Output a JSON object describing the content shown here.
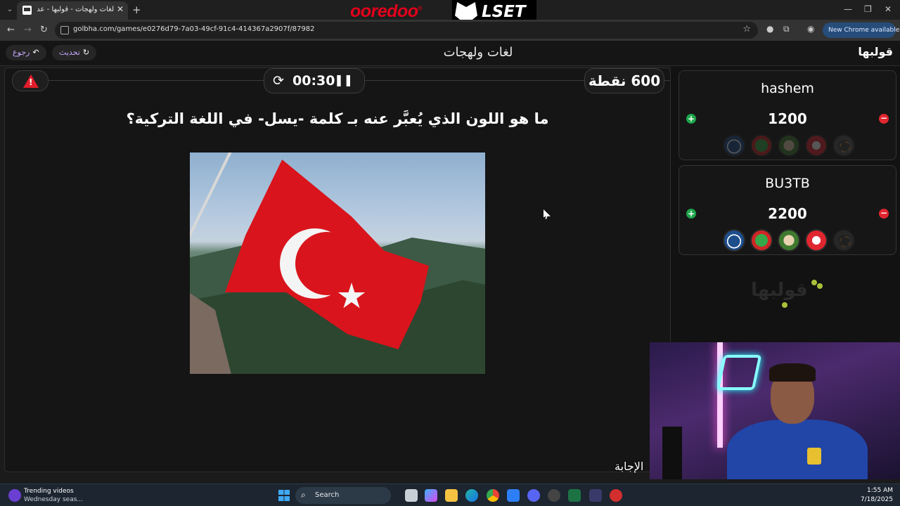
{
  "browser": {
    "tab_title": "لغات ولهجات - قولبها - عدل قبل",
    "url": "golbha.com/games/e0276d79-7a03-49cf-91c4-414367a2907f/87982",
    "chrome_update_label": "New Chrome available"
  },
  "sponsors": {
    "ooredoo": "ooredoo",
    "lset": "LSET"
  },
  "header": {
    "back_label": "رجوع",
    "refresh_label": "تحديث",
    "title": "لغات ولهجات",
    "brand": "قولبها"
  },
  "game": {
    "timer": "00:30",
    "points": "600 نقطة",
    "question": "ما هو اللون الذي يُعبَّر عنه بـ كلمة -يسل- في اللغة التركية؟"
  },
  "teams": [
    {
      "name": "hashem",
      "score": "1200"
    },
    {
      "name": "BU3TB",
      "score": "2200"
    }
  ],
  "watermark": "قولبها",
  "answer_label": "الإجابة",
  "taskbar": {
    "news_title": "Trending videos",
    "news_subtitle": "Wednesday seas...",
    "search_label": "Search",
    "time": "1:55 AM",
    "date": "7/18/2025"
  },
  "colors": {
    "accent_purple": "#c6a8ff",
    "add_green": "#1ea64a",
    "remove_red": "#e0262f",
    "alert_red": "#e11d2a"
  }
}
